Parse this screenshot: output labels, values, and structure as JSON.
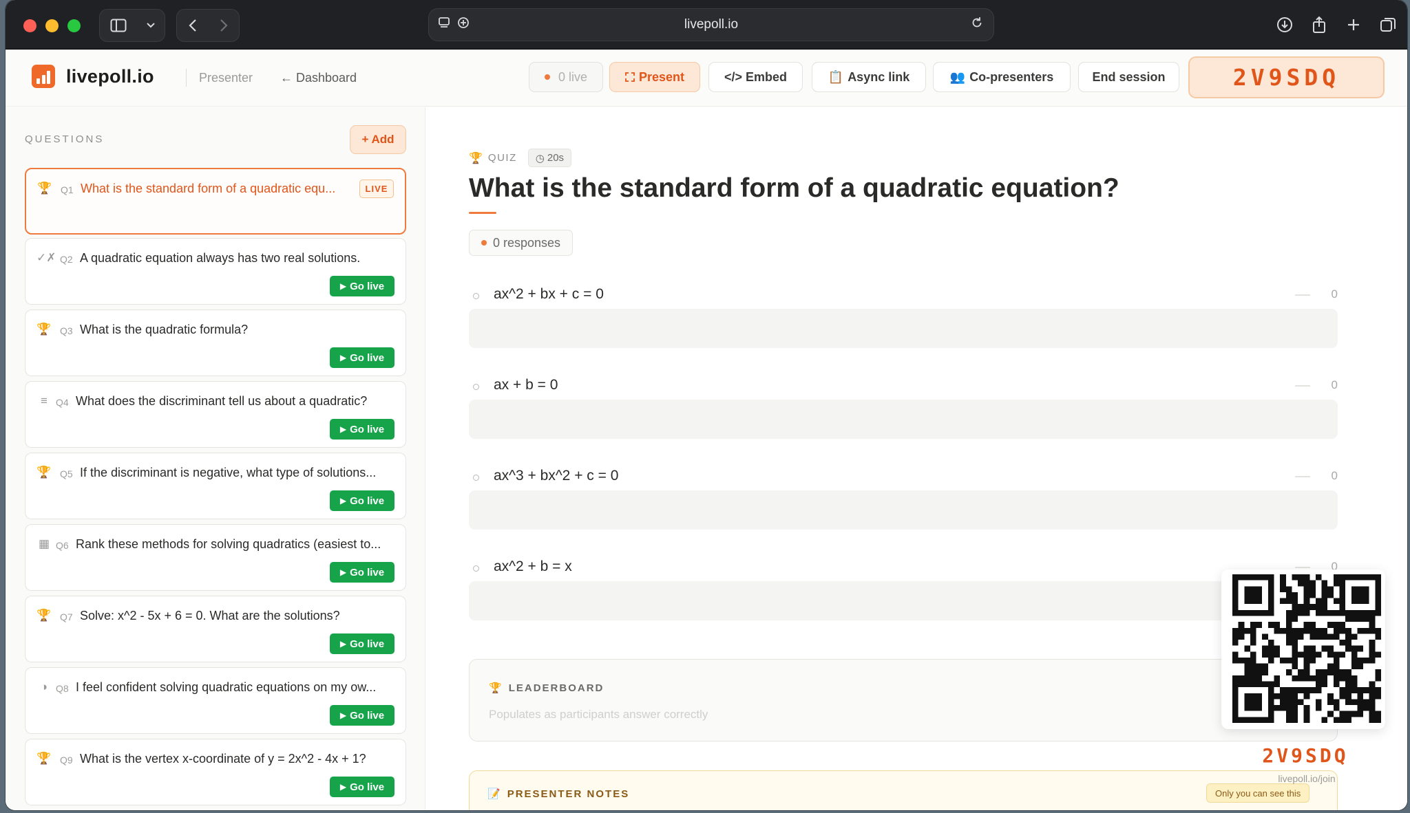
{
  "browser": {
    "url": "livepoll.io"
  },
  "header": {
    "brand": "livepoll.io",
    "presenter_label": "Presenter",
    "dashboard_link": "← Dashboard",
    "live_count": "0 live",
    "present": "Present",
    "embed": "</> Embed",
    "async_link": "Async link",
    "co_presenters": "Co-presenters",
    "end_session": "End session",
    "session_code": "2V9SDQ"
  },
  "sidebar": {
    "title": "QUESTIONS",
    "add_label": "+ Add",
    "go_live_label": "Go live",
    "live_tag": "LIVE",
    "questions": [
      {
        "num": "Q1",
        "icon": "trophy-icon",
        "glyph": "🏆",
        "text": "What is the standard form of a quadratic equ...",
        "live": true
      },
      {
        "num": "Q2",
        "icon": "true-false-icon",
        "glyph": "✓✗",
        "text": "A quadratic equation always has two real solutions.",
        "live": false
      },
      {
        "num": "Q3",
        "icon": "trophy-icon",
        "glyph": "🏆",
        "text": "What is the quadratic formula?",
        "live": false
      },
      {
        "num": "Q4",
        "icon": "list-icon",
        "glyph": "≡",
        "text": "What does the discriminant tell us about a quadratic?",
        "live": false
      },
      {
        "num": "Q5",
        "icon": "trophy-icon",
        "glyph": "🏆",
        "text": "If the discriminant is negative, what type of solutions...",
        "live": false
      },
      {
        "num": "Q6",
        "icon": "ranking-icon",
        "glyph": "▦",
        "text": "Rank these methods for solving quadratics (easiest to...",
        "live": false
      },
      {
        "num": "Q7",
        "icon": "trophy-icon",
        "glyph": "🏆",
        "text": "Solve: x^2 - 5x + 6 = 0. What are the solutions?",
        "live": false
      },
      {
        "num": "Q8",
        "icon": "scale-icon",
        "glyph": "◑",
        "text": "I feel confident solving quadratic equations on my ow...",
        "live": false
      },
      {
        "num": "Q9",
        "icon": "trophy-icon",
        "glyph": "🏆",
        "text": "What is the vertex x-coordinate of y = 2x^2 - 4x + 1?",
        "live": false
      }
    ]
  },
  "main": {
    "type_label": "QUIZ",
    "timer": "20s",
    "question": "What is the standard form of a quadratic equation?",
    "responses": "0 responses",
    "options": [
      {
        "text": "ax^2 + bx + c = 0",
        "count": "0"
      },
      {
        "text": "ax + b = 0",
        "count": "0"
      },
      {
        "text": "ax^3 + bx^2 + c = 0",
        "count": "0"
      },
      {
        "text": "ax^2 + b = x",
        "count": "0"
      }
    ],
    "leaderboard_title": "LEADERBOARD",
    "leaderboard_sub": "Populates as participants answer correctly",
    "notes_title": "PRESENTER NOTES",
    "notes_tag": "Only you can see this"
  },
  "qr": {
    "code": "2V9SDQ",
    "url": "livepoll.io/join"
  },
  "colors": {
    "accent": "#ef6a2a",
    "go_live": "#16a34a"
  }
}
